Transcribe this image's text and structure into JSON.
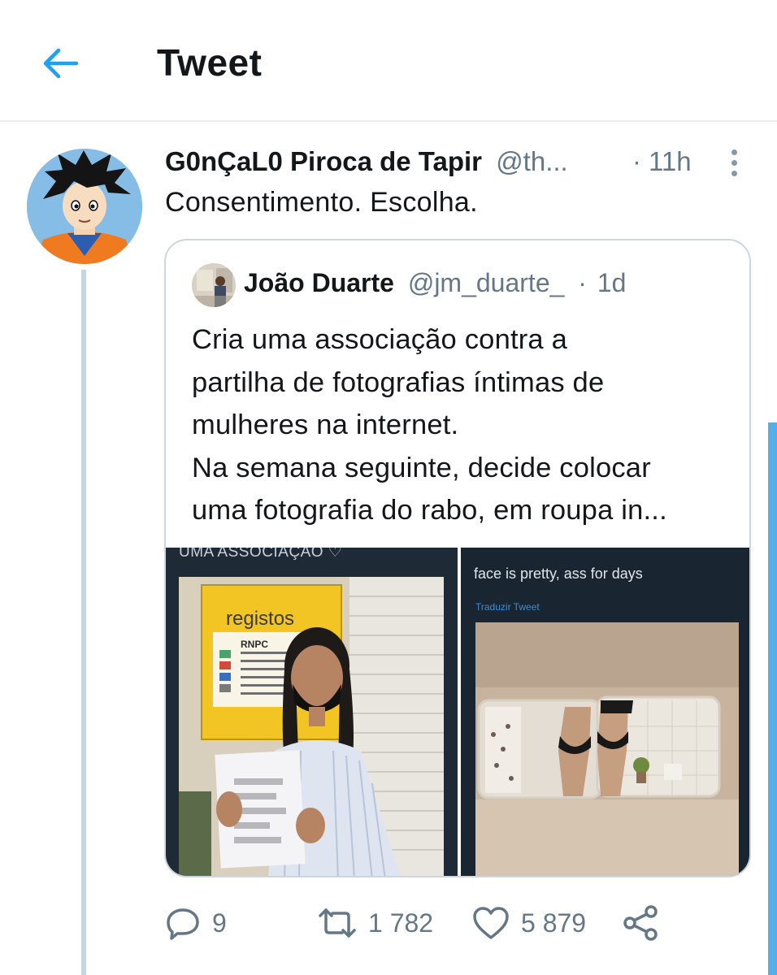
{
  "header": {
    "title": "Tweet"
  },
  "tweet": {
    "author_name": "G0nÇaL0 Piroca de Tapir",
    "author_handle": "@th...",
    "separator": "·",
    "time": "11h",
    "text": "Consentimento. Escolha."
  },
  "quoted": {
    "author_name": "João Duarte",
    "author_handle": "@jm_duarte_",
    "separator": "·",
    "time": "1d",
    "lines": [
      "Cria uma associação contra a",
      "partilha de fotografias íntimas de",
      "mulheres na internet.",
      "Na semana seguinte, decide colocar",
      "uma fotografia do rabo, em roupa in..."
    ],
    "media_left_caption": "UMA ASSOCIAÇÃO ♡",
    "media_left_sign": "registos",
    "media_left_sign_sub": "RNPC",
    "media_right_caption": "face is pretty, ass for days",
    "media_right_translate": "Traduzir Tweet"
  },
  "actions": {
    "replies": "9",
    "retweets": "1 782",
    "likes": "5 879"
  },
  "colors": {
    "accent": "#1da1f2",
    "text_primary": "#14171a",
    "text_secondary": "#657786",
    "border": "#ccd6dd",
    "thread_line": "#c6d6e0"
  }
}
